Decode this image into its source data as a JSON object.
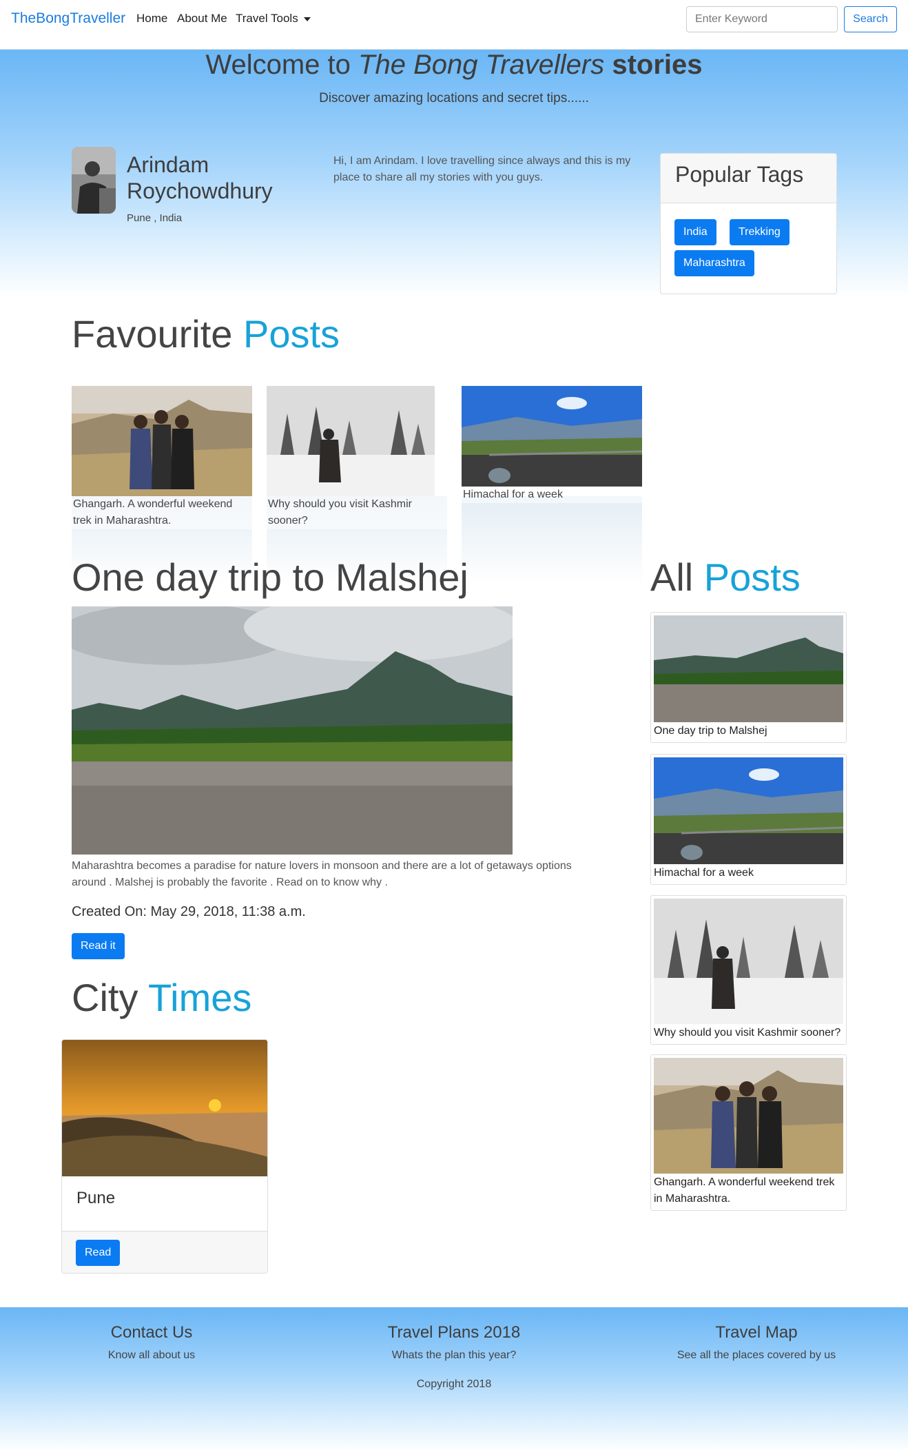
{
  "navbar": {
    "brand": "TheBongTraveller",
    "home": "Home",
    "about": "About Me",
    "tools": "Travel Tools",
    "search_placeholder": "Enter Keyword",
    "search_label": "Search"
  },
  "hero": {
    "title_prefix": "Welcome to ",
    "title_italic": "The Bong Travellers",
    "title_bold": " stories",
    "subtitle": "Discover amazing locations and secret tips......"
  },
  "profile": {
    "name": "Arindam Roychowdhury",
    "location": "Pune , India",
    "bio": "Hi, I am Arindam. I love travelling since always and this is my place to share all my stories with you guys."
  },
  "tags": {
    "title": "Popular Tags",
    "items": [
      "India",
      "Trekking",
      "Maharashtra"
    ]
  },
  "favourites": {
    "title_main": "Favourite ",
    "title_accent": "Posts",
    "items": [
      {
        "caption": "Ghangarh. A wonderful weekend trek in Maharashtra."
      },
      {
        "caption": "Why should you visit Kashmir sooner?"
      },
      {
        "caption": "Himachal for a week"
      }
    ]
  },
  "main_post": {
    "title": "One day trip to Malshej",
    "excerpt": "Maharashtra becomes a paradise for nature lovers in monsoon and there are a lot of getaways options around . Malshej is probably the favorite . Read on to know why .",
    "created": "Created On: May 29, 2018, 11:38 a.m.",
    "read_label": "Read it"
  },
  "city_times": {
    "title_main": "City ",
    "title_accent": "Times",
    "city": "Pune",
    "read_label": "Read"
  },
  "all_posts": {
    "title_main": "All ",
    "title_accent": "Posts",
    "items": [
      {
        "caption": "One day trip to Malshej"
      },
      {
        "caption": "Himachal for a week"
      },
      {
        "caption": "Why should you visit Kashmir sooner?"
      },
      {
        "caption": "Ghangarh. A wonderful weekend trek in Maharashtra."
      }
    ]
  },
  "footer": {
    "contact_title": "Contact Us",
    "contact_sub": "Know all about us",
    "plans_title": "Travel Plans 2018",
    "plans_sub": "Whats the plan this year?",
    "map_title": "Travel Map",
    "map_sub": "See all the places covered by us",
    "copyright": "Copyright 2018"
  },
  "colors": {
    "brand": "#1a7ce0",
    "primary_button": "#0b7bf2",
    "accent_text": "#17a2d8",
    "hero_gradient_top": "#6ab6f5"
  }
}
